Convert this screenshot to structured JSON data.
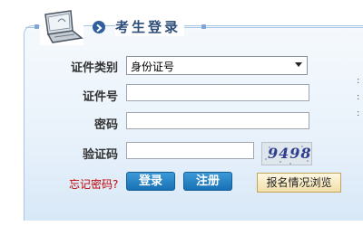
{
  "header": {
    "title": "考生登录"
  },
  "form": {
    "id_type_label": "证件类别",
    "id_type_value": "身份证号",
    "id_number_label": "证件号",
    "id_number_value": "",
    "password_label": "密码",
    "password_value": "",
    "captcha_label": "验证码",
    "captcha_value": "",
    "captcha_image_text": "9498"
  },
  "actions": {
    "forgot_password": "忘记密码?",
    "login": "登录",
    "register": "注册",
    "browse_registration": "报名情况浏览"
  },
  "side_text": [
    ":",
    ":",
    ":"
  ],
  "colors": {
    "accent_blue": "#1770b5",
    "title_text": "#2f4f7a",
    "link_red": "#c00000"
  }
}
